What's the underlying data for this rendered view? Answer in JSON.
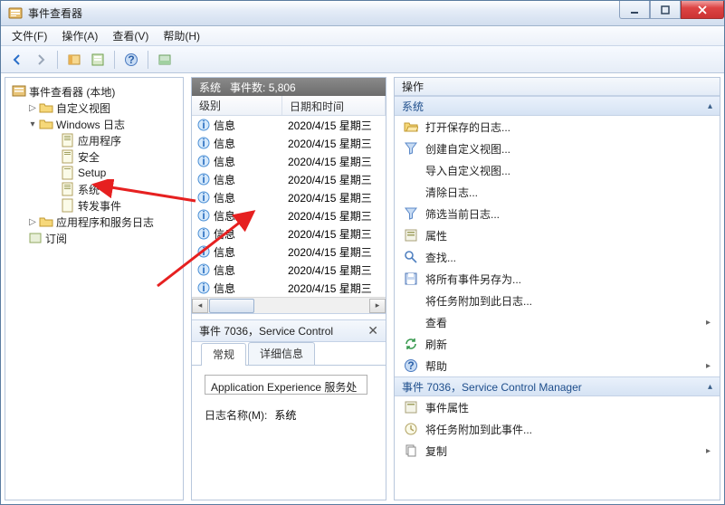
{
  "window": {
    "title": "事件查看器"
  },
  "menu": {
    "file": "文件(F)",
    "action": "操作(A)",
    "view": "查看(V)",
    "help": "帮助(H)"
  },
  "tree": {
    "root": "事件查看器 (本地)",
    "custom_views": "自定义视图",
    "windows_logs": "Windows 日志",
    "application": "应用程序",
    "security": "安全",
    "setup": "Setup",
    "system": "系统",
    "forwarded": "转发事件",
    "app_service_logs": "应用程序和服务日志",
    "subscriptions": "订阅"
  },
  "mid": {
    "header_log": "系统",
    "header_count": "事件数: 5,806",
    "col_level": "级别",
    "col_datetime": "日期和时间",
    "row_level": "信息",
    "row_dt": "2020/4/15 星期三"
  },
  "detail": {
    "title": "事件 7036，Service Control",
    "tab_general": "常规",
    "tab_details": "详细信息",
    "body_text": "Application Experience 服务处",
    "log_name_label": "日志名称(M):",
    "log_name_value": "系统"
  },
  "actions": {
    "header": "操作",
    "group_system": "系统",
    "open_saved": "打开保存的日志...",
    "create_custom": "创建自定义视图...",
    "import_custom": "导入自定义视图...",
    "clear_log": "清除日志...",
    "filter_current": "筛选当前日志...",
    "properties": "属性",
    "find": "查找...",
    "save_all_as": "将所有事件另存为...",
    "attach_task_log": "将任务附加到此日志...",
    "view": "查看",
    "refresh": "刷新",
    "help": "帮助",
    "group_event": "事件 7036，Service Control Manager",
    "event_props": "事件属性",
    "attach_task_event": "将任务附加到此事件...",
    "copy": "复制"
  }
}
